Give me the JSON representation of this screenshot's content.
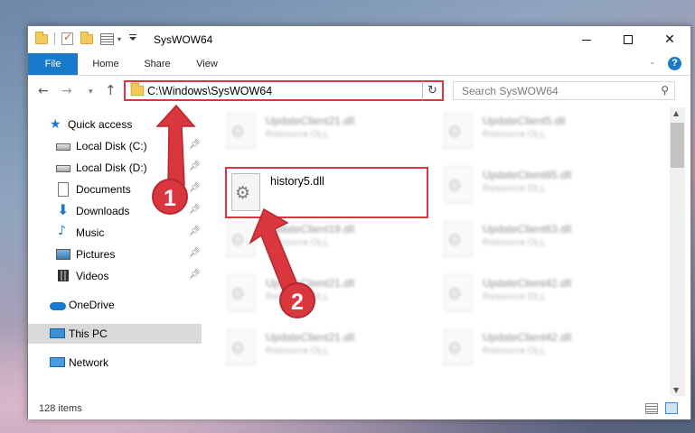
{
  "window": {
    "title": "SysWOW64"
  },
  "ribbon": {
    "tabs": [
      "File",
      "Home",
      "Share",
      "View"
    ],
    "help": "?"
  },
  "address": {
    "path": "C:\\Windows\\SysWOW64",
    "search_placeholder": "Search SysWOW64"
  },
  "sidebar": {
    "quick_access": "Quick access",
    "items": [
      {
        "label": "Local Disk (C:)",
        "icon": "drive-icon",
        "pinned": true
      },
      {
        "label": "Local Disk (D:)",
        "icon": "drive-icon",
        "pinned": true
      },
      {
        "label": "Documents",
        "icon": "documents-icon",
        "pinned": true
      },
      {
        "label": "Downloads",
        "icon": "download-icon",
        "pinned": true
      },
      {
        "label": "Music",
        "icon": "music-icon",
        "pinned": true
      },
      {
        "label": "Pictures",
        "icon": "pictures-icon",
        "pinned": true
      },
      {
        "label": "Videos",
        "icon": "videos-icon",
        "pinned": true
      }
    ],
    "onedrive": "OneDrive",
    "this_pc": "This PC",
    "network": "Network"
  },
  "files": {
    "left_column": [
      {
        "name": "UpdateClient21.dll",
        "type": "Resource DLL"
      },
      {
        "name": "UpdateClient19.dll",
        "type": "Resource DLL"
      },
      {
        "name": "UpdateClient21.dll",
        "type": "Resource DLL"
      },
      {
        "name": "UpdateClient21.dll",
        "type": "Resource DLL"
      }
    ],
    "right_column": [
      {
        "name": "UpdateClient5.dll",
        "type": "Resource DLL"
      },
      {
        "name": "UpdateClient65.dll",
        "type": "Resource DLL"
      },
      {
        "name": "UpdateClient63.dll",
        "type": "Resource DLL"
      },
      {
        "name": "UpdateClient42.dll",
        "type": "Resource DLL"
      },
      {
        "name": "UpdateClient42.dll",
        "type": "Resource DLL"
      }
    ],
    "highlighted": {
      "name": "history5.dll"
    }
  },
  "status": {
    "item_count": "128 items"
  },
  "annotations": {
    "step1": "1",
    "step2": "2",
    "color": "#d9363e"
  }
}
